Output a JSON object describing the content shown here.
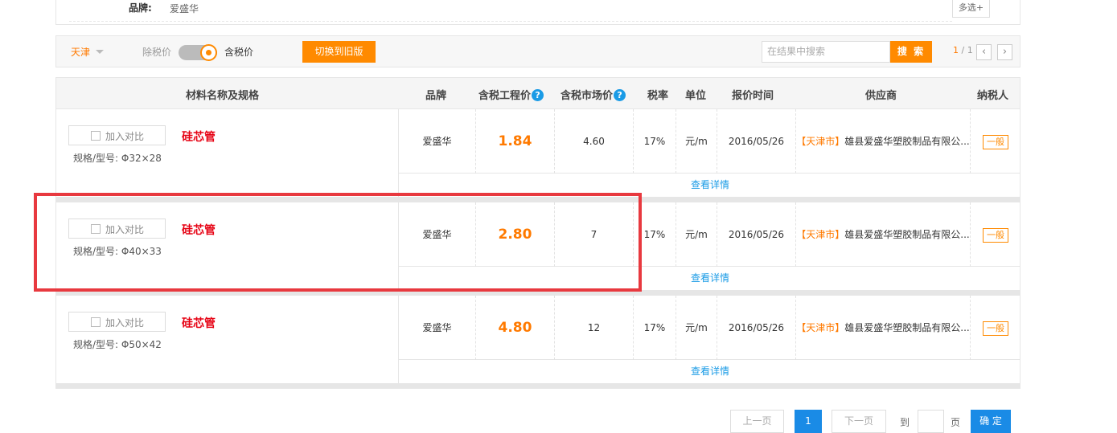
{
  "brand_filter": {
    "label": "品牌:",
    "value": "爱盛华",
    "multi_select": "多选+"
  },
  "toolbar": {
    "city": "天津",
    "excl_tax": "除税价",
    "incl_tax": "含税价",
    "switch_btn": "切换到旧版",
    "search_placeholder": "在结果中搜索",
    "search_btn": "搜 索",
    "page_current": "1",
    "page_total": "/ 1",
    "prev_arrow": "‹",
    "next_arrow": "›"
  },
  "table_header": {
    "name": "材料名称及规格",
    "brand": "品牌",
    "eng_price": "含税工程价",
    "mkt_price": "含税市场价",
    "q": "?",
    "tax": "税率",
    "unit": "单位",
    "date": "报价时间",
    "supplier": "供应商",
    "taxpayer": "纳税人"
  },
  "rows": [
    {
      "compare": "加入对比",
      "name": "硅芯管",
      "spec": "规格/型号: Φ32×28",
      "brand": "爱盛华",
      "eng_price": "1.84",
      "mkt_price": "4.60",
      "tax": "17%",
      "unit": "元/m",
      "date": "2016/05/26",
      "region": "【天津市】",
      "supplier": "雄县爱盛华塑胶制品有限公...",
      "taxpayer": "一般",
      "detail": "查看详情"
    },
    {
      "compare": "加入对比",
      "name": "硅芯管",
      "spec": "规格/型号: Φ40×33",
      "brand": "爱盛华",
      "eng_price": "2.80",
      "mkt_price": "7",
      "tax": "17%",
      "unit": "元/m",
      "date": "2016/05/26",
      "region": "【天津市】",
      "supplier": "雄县爱盛华塑胶制品有限公...",
      "taxpayer": "一般",
      "detail": "查看详情"
    },
    {
      "compare": "加入对比",
      "name": "硅芯管",
      "spec": "规格/型号: Φ50×42",
      "brand": "爱盛华",
      "eng_price": "4.80",
      "mkt_price": "12",
      "tax": "17%",
      "unit": "元/m",
      "date": "2016/05/26",
      "region": "【天津市】",
      "supplier": "雄县爱盛华塑胶制品有限公...",
      "taxpayer": "一般",
      "detail": "查看详情"
    }
  ],
  "pagination": {
    "prev": "上一页",
    "current": "1",
    "next": "下一页",
    "goto": "到",
    "page": "页",
    "confirm": "确 定"
  },
  "colors": {
    "accent": "#ff8a00",
    "price": "#ff7a00",
    "link": "#1a9be6",
    "product": "#e60012",
    "highlight": "#e8393f"
  }
}
